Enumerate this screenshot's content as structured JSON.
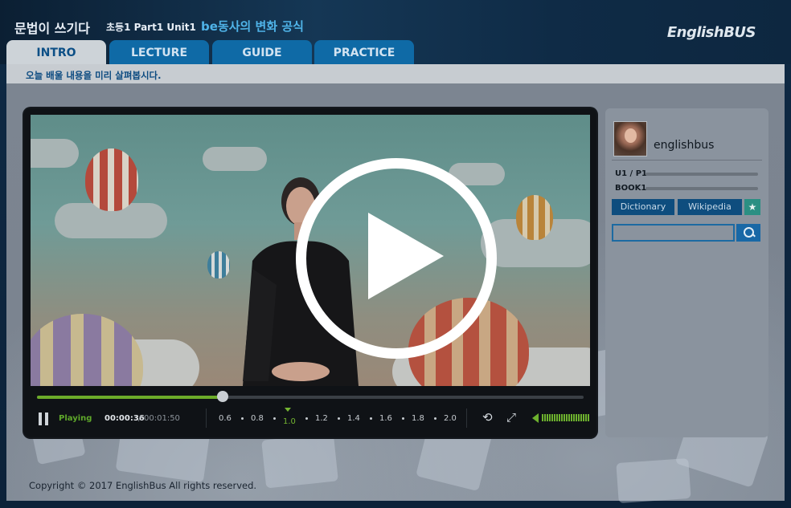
{
  "header": {
    "title": "문법이 쓰기다",
    "subtitle": "초등1 Part1 Unit1",
    "topic": "be동사의 변화 공식",
    "logo": "EnglishBUS"
  },
  "tabs": [
    {
      "label": "INTRO",
      "active": true
    },
    {
      "label": "LECTURE",
      "active": false
    },
    {
      "label": "GUIDE",
      "active": false
    },
    {
      "label": "PRACTICE",
      "active": false
    }
  ],
  "infobar": {
    "text": "오늘 배울 내용을 미리 살펴봅시다."
  },
  "player": {
    "status": "Playing",
    "current_time": "00:00:36",
    "separator": "/",
    "total_time": "00:01:50",
    "progress_fraction": 0.34,
    "speeds": [
      "0.6",
      "0.8",
      "1.0",
      "1.2",
      "1.4",
      "1.6",
      "1.8",
      "2.0"
    ],
    "active_speed": "1.0"
  },
  "sidebar": {
    "username": "englishbus",
    "unit": "U1 / P1",
    "book": "BOOK1",
    "buttons": {
      "dictionary": "Dictionary",
      "wikipedia": "Wikipedia"
    },
    "search_placeholder": ""
  },
  "footer": {
    "copyright": "Copyright © 2017 EnglishBus All rights reserved."
  },
  "icons": {
    "play": "play-circle-icon",
    "pause": "pause-icon",
    "repeat": "repeat-icon",
    "fullscreen": "fullscreen-icon",
    "volume": "volume-icon",
    "star": "star-icon",
    "search": "search-icon"
  },
  "colors": {
    "accent_blue": "#0f6aa6",
    "accent_green": "#6cab2a",
    "topic_blue": "#4fb3e8"
  }
}
